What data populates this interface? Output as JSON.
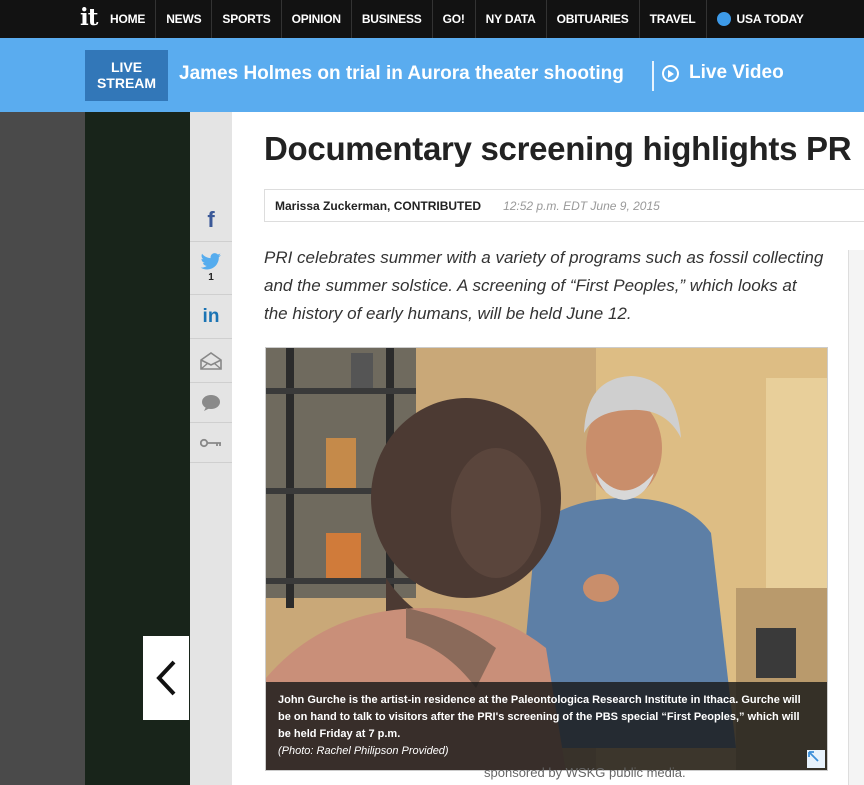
{
  "nav": {
    "logo": "it",
    "items": [
      "HOME",
      "NEWS",
      "SPORTS",
      "OPINION",
      "BUSINESS",
      "GO!",
      "NY DATA",
      "OBITUARIES",
      "TRAVEL"
    ],
    "usa_today": "USA TODAY"
  },
  "live": {
    "badge_line1": "LIVE",
    "badge_line2": "STREAM",
    "title": "James Holmes on trial in Aurora theater shooting",
    "video_label": "Live Video"
  },
  "share": {
    "twitter_count": "1"
  },
  "article": {
    "headline": "Documentary screening highlights PR",
    "author": "Marissa Zuckerman, CONTRIBUTED",
    "timestamp": "12:52 p.m. EDT June 9, 2015",
    "summary": "PRI celebrates summer with a variety of programs such as fossil collecting and the summer solstice. A screening of “First Peoples,” which looks at the history of early humans, will be held June 12.",
    "caption": "John Gurche is the artist-in residence at the Paleontologica Research Institute in Ithaca. Gurche will be on hand to talk to visitors after the PRI's screening of the PBS special “First Peoples,” which will be held Friday at 7 p.m.",
    "credit": "(Photo: Rachel Philipson Provided)",
    "sponsor": "sponsored by WSKG public media."
  },
  "colors": {
    "nav_bg": "#121212",
    "live_bar": "#5aacef",
    "live_badge": "#3277b8",
    "facebook": "#3b5998",
    "twitter": "#55acee",
    "linkedin": "#1b74b4"
  }
}
